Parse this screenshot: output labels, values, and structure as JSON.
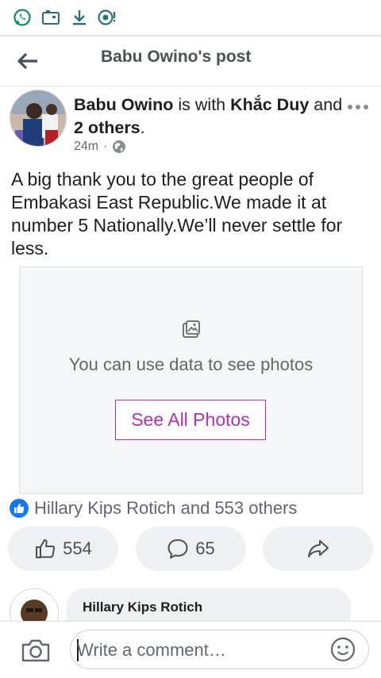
{
  "status_bar": {
    "icons": [
      "whatsapp-icon",
      "camera-card-icon",
      "download-icon",
      "notification-icon"
    ]
  },
  "header": {
    "title": "Babu Owino's post"
  },
  "post": {
    "author": "Babu Owino",
    "connector": "is with",
    "with_name": "Khắc Duy",
    "and_word": "and",
    "others": "2 others",
    "time": "24m",
    "separator": "·",
    "privacy_icon": "globe-icon",
    "text": "A big thank you to the great people of Embakasi East Republic.We made it at number 5 Nationally.We’ll never settle for less."
  },
  "photos": {
    "message": "You can use data to see photos",
    "button_label": "See All Photos"
  },
  "reactions": {
    "summary": "Hillary Kips Rotich and 553 others"
  },
  "actions": {
    "like_count": "554",
    "comment_count": "65"
  },
  "comment": {
    "author": "Hillary Kips Rotich"
  },
  "composer": {
    "placeholder": "Write a comment…"
  },
  "colors": {
    "accent": "#b02fbf",
    "like_blue": "#1877f2",
    "whatsapp_green": "#0a8f5a"
  }
}
